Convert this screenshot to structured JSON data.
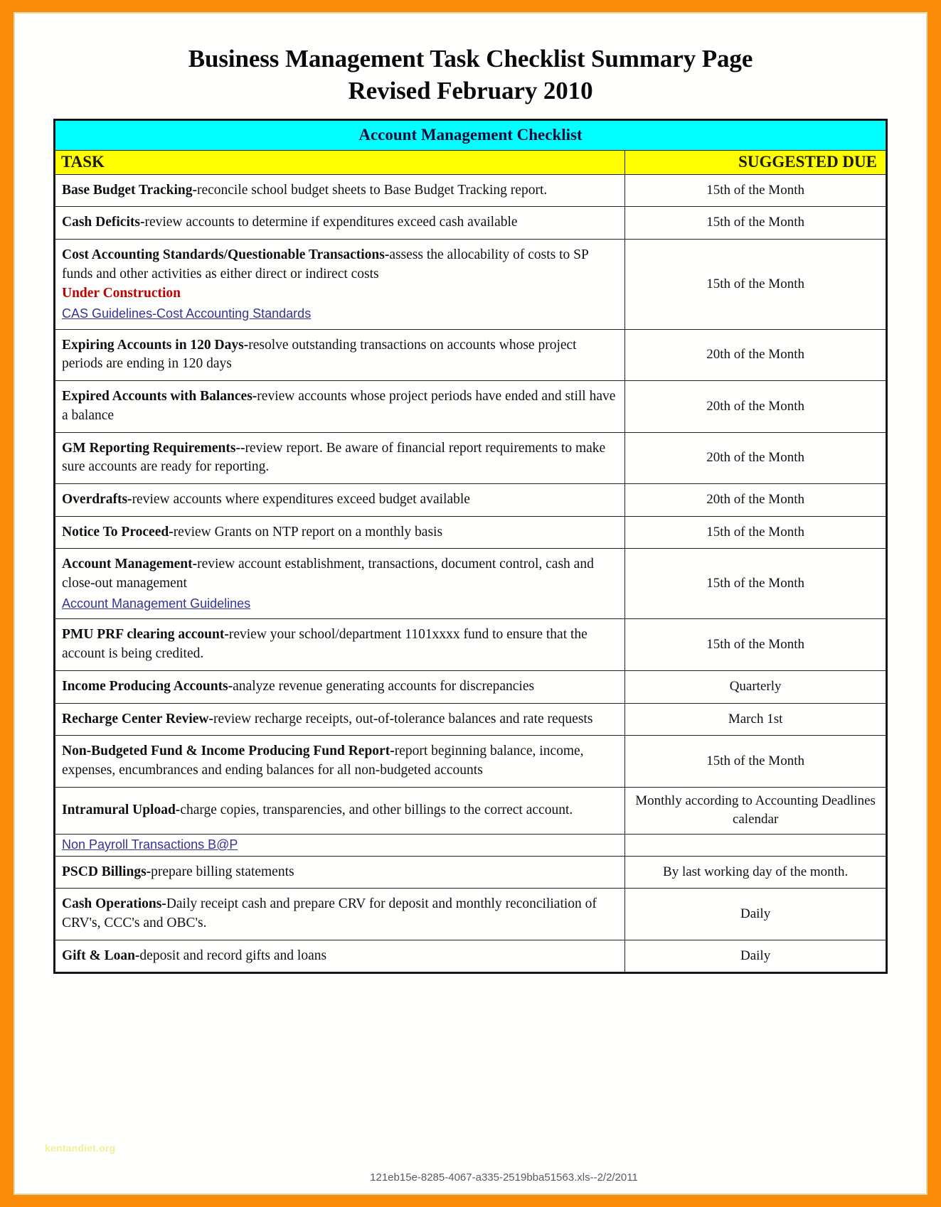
{
  "document": {
    "title_line1": "Business Management Task Checklist Summary Page",
    "title_line2": "Revised February 2010",
    "banner": "Account Management Checklist",
    "watermark": "kentandiet.org",
    "footer_id": "121eb15e-8285-4067-a335-2519bba51563.xls--2/2/2011"
  },
  "colors": {
    "page_border": "#FA8B08",
    "banner_bg": "#00FFFF",
    "header_bg": "#FFFF00",
    "link": "#333399",
    "alert": "#C00000"
  },
  "table": {
    "headers": {
      "task": "TASK",
      "due": "SUGGESTED DUE"
    },
    "rows": [
      {
        "name": "Base Budget Tracking-",
        "desc": "reconcile school budget sheets to Base Budget Tracking report.",
        "due": "15th of the Month"
      },
      {
        "name": "Cash Deficits-",
        "desc": "review accounts to determine if expenditures exceed cash available",
        "due": "15th of the Month"
      },
      {
        "name": "Cost Accounting Standards/Questionable Transactions-",
        "desc": "assess the allocability of costs to SP funds and other activities as either direct or indirect costs",
        "alert": "Under Construction",
        "link": "CAS Guidelines-Cost Accounting Standards",
        "due": "15th of the Month"
      },
      {
        "name": "Expiring Accounts in 120 Days-",
        "desc": "resolve outstanding transactions on accounts whose project periods are ending in 120 days",
        "due": "20th of the Month"
      },
      {
        "name": "Expired Accounts with Balances-",
        "desc": "review accounts whose project periods have ended and still have a balance",
        "due": "20th of the Month"
      },
      {
        "name": "GM Reporting Requirements--",
        "desc": "review report.  Be aware of financial report requirements to make sure accounts are ready for reporting.",
        "due": "20th of the Month"
      },
      {
        "name": "Overdrafts-",
        "desc": "review accounts where expenditures exceed budget available",
        "due": "20th of the Month"
      },
      {
        "name": "Notice To Proceed-",
        "desc": "review Grants on NTP report on a monthly basis",
        "due": "15th of the Month"
      },
      {
        "name": "Account Management-",
        "desc": "review account establishment, transactions, document control, cash and close-out management",
        "link": "Account Management Guidelines",
        "due": "15th of the Month"
      },
      {
        "name": "PMU PRF clearing account-",
        "desc": "review your school/department 1101xxxx fund to ensure that the account is being credited.",
        "due": "15th of the Month"
      },
      {
        "name": "Income Producing Accounts-",
        "desc": "analyze revenue generating accounts for discrepancies",
        "due": "Quarterly"
      },
      {
        "name": "Recharge Center Review-",
        "desc": "review recharge receipts, out-of-tolerance balances and rate requests",
        "due": "March 1st"
      },
      {
        "name": "Non-Budgeted Fund & Income Producing Fund Report-",
        "desc": "report beginning balance, income, expenses, encumbrances and ending balances for all non-budgeted accounts",
        "due": "15th of the Month"
      },
      {
        "name": "Intramural Upload-",
        "desc": "charge copies, transparencies, and other billings to the correct account.",
        "due": "Monthly according to Accounting Deadlines calendar"
      },
      {
        "link_only": "Non Payroll Transactions B@P",
        "due": ""
      },
      {
        "name": "PSCD Billings-",
        "desc": "prepare billing statements",
        "due": "By last working day of the month."
      },
      {
        "name": "Cash Operations-",
        "desc": "Daily receipt cash and prepare CRV for deposit and monthly reconciliation of CRV's, CCC's  and OBC's.",
        "due": "Daily"
      },
      {
        "name": "Gift & Loan-",
        "desc": "deposit and record gifts and loans",
        "due": "Daily"
      }
    ]
  }
}
